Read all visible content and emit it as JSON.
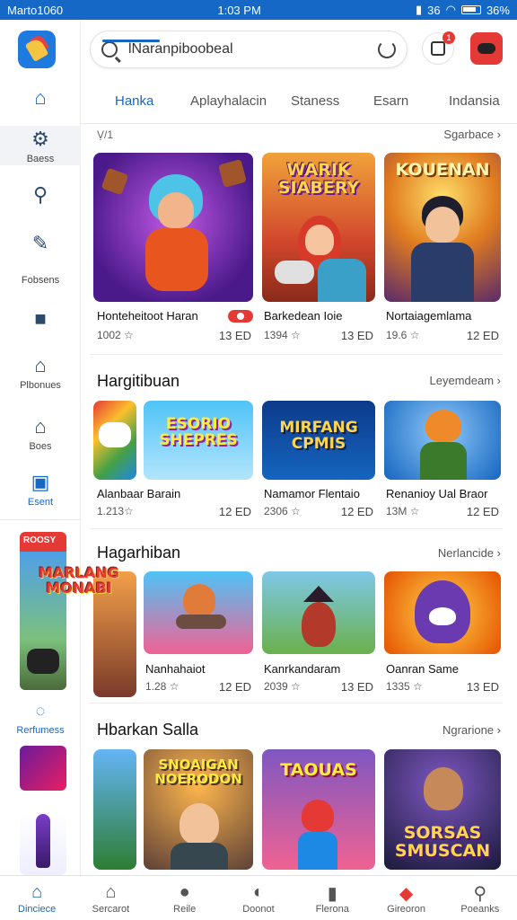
{
  "status": {
    "carrier": "Marto1060",
    "time": "1:03 PM",
    "battery": "36%",
    "signal": "36"
  },
  "search": {
    "value": "lNaranpiboobeal"
  },
  "store_badge": "1",
  "rail": {
    "items": [
      {
        "label": ""
      },
      {
        "label": "Baess"
      },
      {
        "label": ""
      },
      {
        "label": "Fobsens"
      },
      {
        "label": ""
      },
      {
        "label": "Plbonues"
      },
      {
        "label": "Boes"
      },
      {
        "label": "Esent"
      },
      {
        "label": "Rerfumess"
      }
    ]
  },
  "tabs": [
    "Hanka",
    "Aplayhalacin",
    "Staness",
    "Esarn",
    "Indansia"
  ],
  "sections": [
    {
      "title": "",
      "sub": "Ṿ/1",
      "more": "Sgarbace",
      "cards": [
        {
          "name": "Honteheitoot Haran",
          "meta": "1002 ☆",
          "price": "13 ED"
        },
        {
          "name": "Barkedean Ioie",
          "meta": "1394 ☆",
          "price": "13 ED"
        },
        {
          "name": "Nortaiagemlama",
          "meta": "19.6 ☆",
          "price": "12 ED"
        }
      ],
      "arts": [
        "",
        "WARIK SIABERY",
        "KOUENAN"
      ]
    },
    {
      "title": "Hargitibuan",
      "more": "Leyemdeam",
      "cards": [
        {
          "name": "Alanbaar Barain",
          "meta": "1.213☆",
          "price": "12 ED"
        },
        {
          "name": "Namamor Flentaio",
          "meta": "2306 ☆",
          "price": "12 ED"
        },
        {
          "name": "Renanioy Ual Braor",
          "meta": "13M ☆",
          "price": "12 ED"
        }
      ],
      "arts": [
        "ESORIO SHEPRES",
        "MIRFANG CPMIS"
      ]
    },
    {
      "title": "Hagarhiban",
      "more": "Nerlancide",
      "cards": [
        {
          "name": "Nanhahaiot",
          "meta": "1.28 ☆",
          "price": "12 ED"
        },
        {
          "name": "Kanrkandaram",
          "meta": "2039 ☆",
          "price": "13 ED"
        },
        {
          "name": "Oanran Same",
          "meta": "1335 ☆",
          "price": "13 ED"
        }
      ],
      "arts": [
        "MARLANG MONABI"
      ]
    },
    {
      "title": "Hbarkan Salla",
      "more": "Ngrarione",
      "arts": [
        "SNOAIGAN NOERODON",
        "TAOUAS",
        "SORSAS SMUSCAN"
      ]
    }
  ],
  "bottomnav": [
    "Dinciece",
    "Sercarot",
    "Reile",
    "Doonot",
    "Flerona",
    "Gireoron",
    "Poeanks"
  ],
  "colors": {
    "accent": "#1668c6",
    "red": "#e53935"
  }
}
